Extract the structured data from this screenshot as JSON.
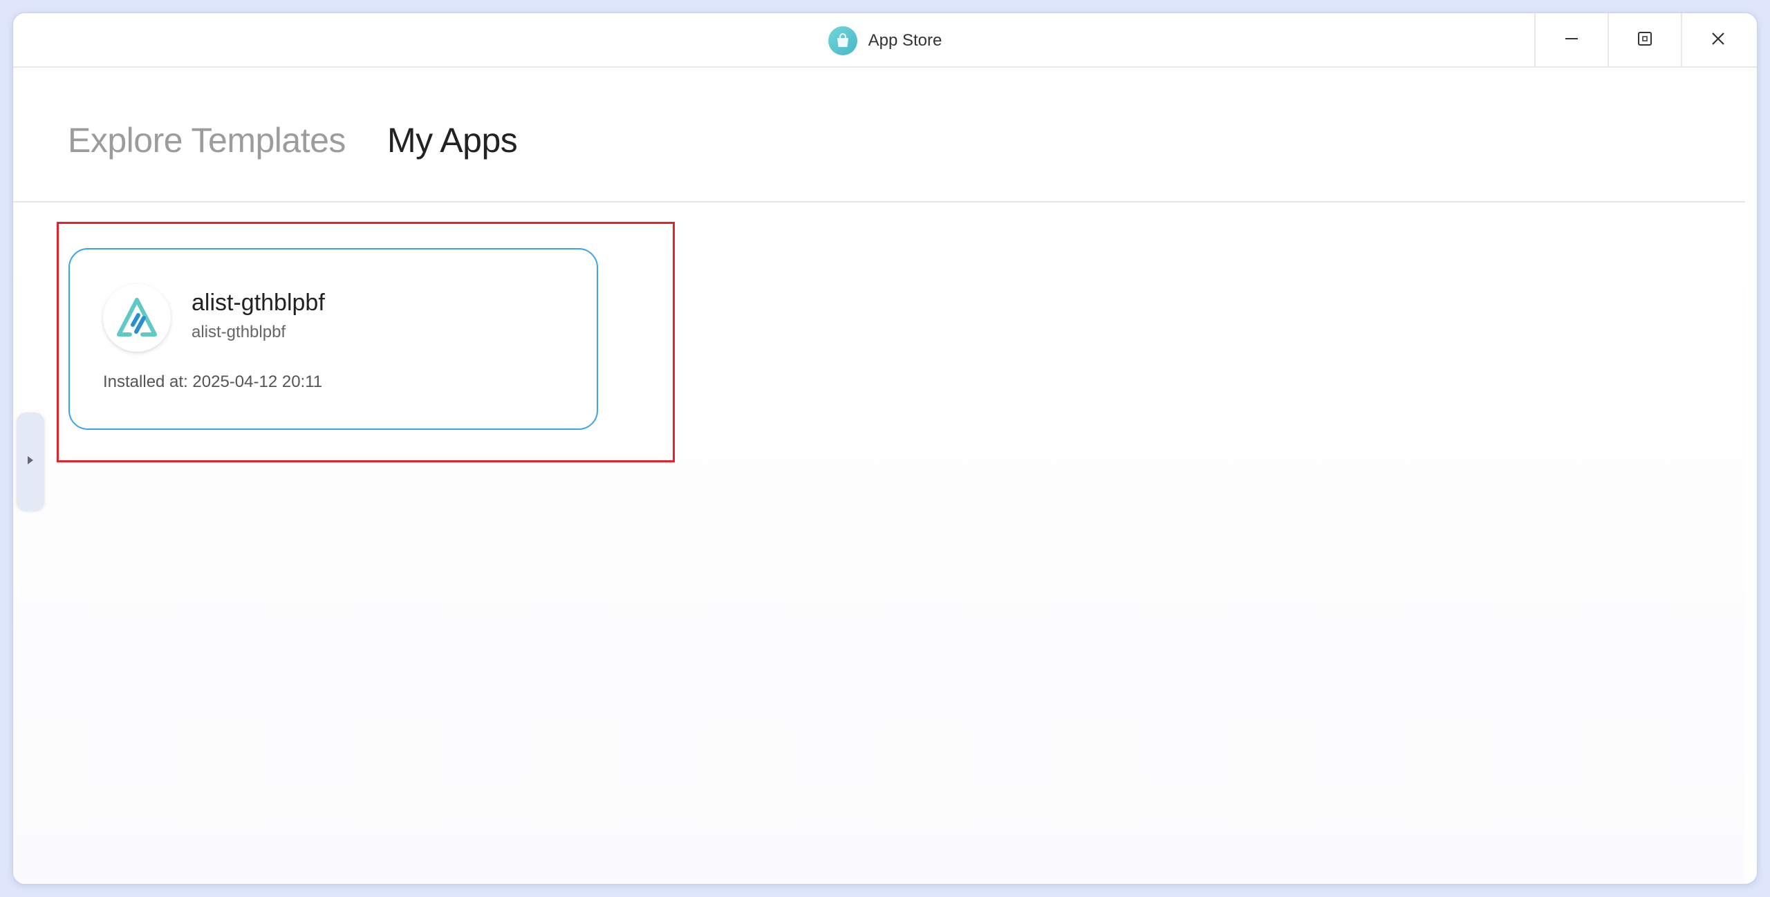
{
  "window": {
    "title": "App Store",
    "icons": {
      "logo": "shopping-bag-icon",
      "minimize": "minimize-icon",
      "maximize": "maximize-icon",
      "close": "close-icon"
    }
  },
  "tabs": [
    {
      "label": "Explore Templates",
      "active": false
    },
    {
      "label": "My Apps",
      "active": true
    }
  ],
  "apps": [
    {
      "name": "alist-gthblpbf",
      "subtitle": "alist-gthblpbf",
      "installed": "Installed at: 2025-04-12 20:11",
      "icon": "alist-logo-icon"
    }
  ],
  "sidebar_toggle": {
    "icon": "caret-right-icon"
  },
  "colors": {
    "accent": "#3aa4e8",
    "highlight": "#e8202a",
    "logo": "#6fd6d8"
  }
}
